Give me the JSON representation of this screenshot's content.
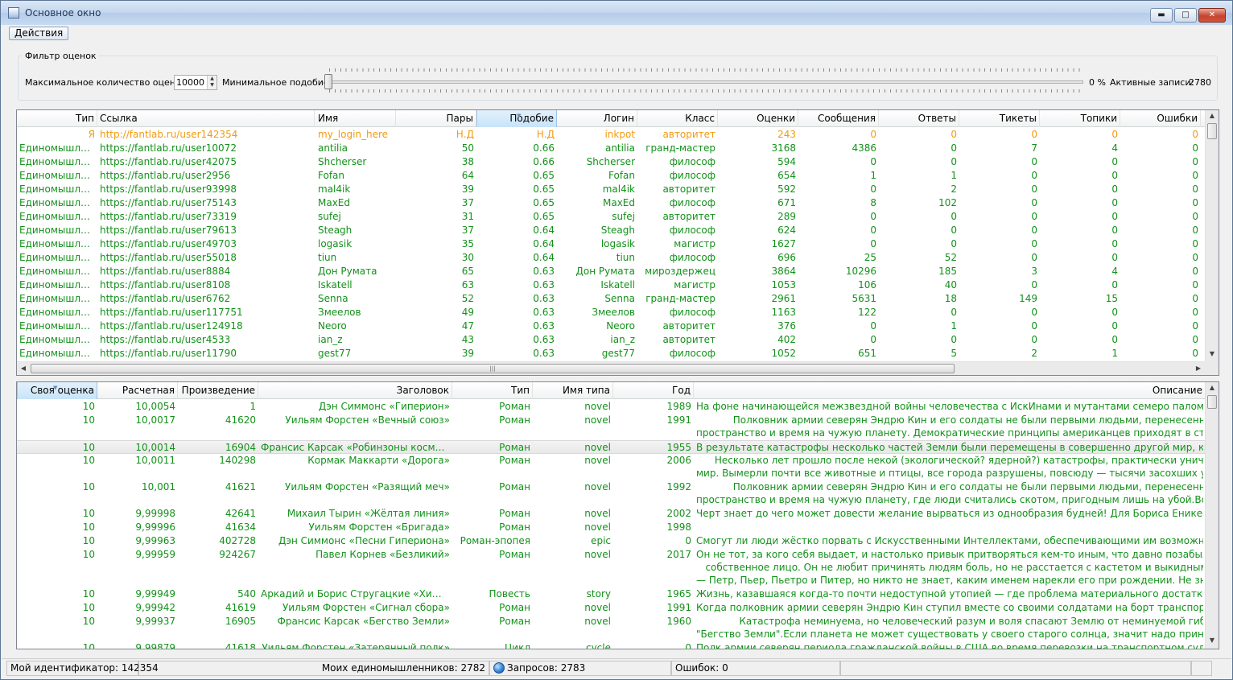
{
  "window": {
    "title": "Основное окно"
  },
  "menu": {
    "actions": "Действия"
  },
  "filter": {
    "group_title": "Фильтр оценок",
    "max_ratings_label": "Максимальное количество оценок:",
    "max_ratings_value": "10000",
    "min_similarity_label": "Минимальное  подобие:",
    "similarity_value": "0 %",
    "active_records_label": "Активные записи:",
    "active_records_value": "2780"
  },
  "colors": {
    "self": "#f39a10",
    "other": "#13911a"
  },
  "users_table": {
    "columns": [
      "Тип",
      "Ссылка",
      "Имя",
      "Пары",
      "Подобие",
      "Логин",
      "Класс",
      "Оценки",
      "Сообщения",
      "Ответы",
      "Тикеты",
      "Топики",
      "Ошибки"
    ],
    "rows": [
      {
        "self": true,
        "cells": [
          "Я",
          "http://fantlab.ru/user142354",
          "my_login_here",
          "Н.Д",
          "Н.Д",
          "inkpot",
          "авторитет",
          "243",
          "0",
          "0",
          "0",
          "0",
          "0"
        ]
      },
      {
        "cells": [
          "Единомышлен...",
          "https://fantlab.ru/user10072",
          "antilia",
          "50",
          "0.66",
          "antilia",
          "гранд-мастер",
          "3168",
          "4386",
          "0",
          "7",
          "4",
          "0"
        ]
      },
      {
        "cells": [
          "Единомышлен...",
          "https://fantlab.ru/user42075",
          "Shcherser",
          "38",
          "0.66",
          "Shcherser",
          "философ",
          "594",
          "0",
          "0",
          "0",
          "0",
          "0"
        ]
      },
      {
        "cells": [
          "Единомышлен...",
          "https://fantlab.ru/user2956",
          "Fofan",
          "64",
          "0.65",
          "Fofan",
          "философ",
          "654",
          "1",
          "1",
          "0",
          "0",
          "0"
        ]
      },
      {
        "cells": [
          "Единомышлен...",
          "https://fantlab.ru/user93998",
          "mal4ik",
          "39",
          "0.65",
          "mal4ik",
          "авторитет",
          "592",
          "0",
          "2",
          "0",
          "0",
          "0"
        ]
      },
      {
        "cells": [
          "Единомышлен...",
          "https://fantlab.ru/user75143",
          "MaxEd",
          "37",
          "0.65",
          "MaxEd",
          "философ",
          "671",
          "8",
          "102",
          "0",
          "0",
          "0"
        ]
      },
      {
        "cells": [
          "Единомышлен...",
          "https://fantlab.ru/user73319",
          "sufej",
          "31",
          "0.65",
          "sufej",
          "авторитет",
          "289",
          "0",
          "0",
          "0",
          "0",
          "0"
        ]
      },
      {
        "cells": [
          "Единомышлен...",
          "https://fantlab.ru/user79613",
          "Steagh",
          "37",
          "0.64",
          "Steagh",
          "философ",
          "624",
          "0",
          "0",
          "0",
          "0",
          "0"
        ]
      },
      {
        "cells": [
          "Единомышлен...",
          "https://fantlab.ru/user49703",
          "logasik",
          "35",
          "0.64",
          "logasik",
          "магистр",
          "1627",
          "0",
          "0",
          "0",
          "0",
          "0"
        ]
      },
      {
        "cells": [
          "Единомышлен...",
          "https://fantlab.ru/user55018",
          "tiun",
          "30",
          "0.64",
          "tiun",
          "философ",
          "696",
          "25",
          "52",
          "0",
          "0",
          "0"
        ]
      },
      {
        "cells": [
          "Единомышлен...",
          "https://fantlab.ru/user8884",
          "Дон Румата",
          "65",
          "0.63",
          "Дон Румата",
          "мироздержец",
          "3864",
          "10296",
          "185",
          "3",
          "4",
          "0"
        ]
      },
      {
        "cells": [
          "Единомышлен...",
          "https://fantlab.ru/user8108",
          "Iskatell",
          "63",
          "0.63",
          "Iskatell",
          "магистр",
          "1053",
          "106",
          "40",
          "0",
          "0",
          "0"
        ]
      },
      {
        "cells": [
          "Единомышлен...",
          "https://fantlab.ru/user6762",
          "Senna",
          "52",
          "0.63",
          "Senna",
          "гранд-мастер",
          "2961",
          "5631",
          "18",
          "149",
          "15",
          "0"
        ]
      },
      {
        "cells": [
          "Единомышлен...",
          "https://fantlab.ru/user117751",
          "Змеелов",
          "49",
          "0.63",
          "Змеелов",
          "философ",
          "1163",
          "122",
          "0",
          "0",
          "0",
          "0"
        ]
      },
      {
        "cells": [
          "Единомышлен...",
          "https://fantlab.ru/user124918",
          "Neoro",
          "47",
          "0.63",
          "Neoro",
          "авторитет",
          "376",
          "0",
          "1",
          "0",
          "0",
          "0"
        ]
      },
      {
        "cells": [
          "Единомышлен...",
          "https://fantlab.ru/user4533",
          "ian_z",
          "43",
          "0.63",
          "ian_z",
          "авторитет",
          "402",
          "0",
          "0",
          "0",
          "0",
          "0"
        ]
      },
      {
        "cells": [
          "Единомышлен...",
          "https://fantlab.ru/user11790",
          "gest77",
          "39",
          "0.63",
          "gest77",
          "философ",
          "1052",
          "651",
          "5",
          "2",
          "1",
          "0"
        ]
      }
    ]
  },
  "works_table": {
    "columns": [
      "Своя оценка",
      "Расчетная",
      "Произведение",
      "Заголовок",
      "Тип",
      "Имя типа",
      "Год",
      "Описание"
    ],
    "rows": [
      {
        "cells": [
          "10",
          "10,0054",
          "1",
          "Дэн Симмонс «Гиперион»",
          "Роман",
          "novel",
          "1989"
        ],
        "desc": [
          "На фоне начинающейся межзвездной войны человечества с ИскИнами и мутантами семеро паломников нап..."
        ]
      },
      {
        "cells": [
          "10",
          "10,0017",
          "41620",
          "Уильям Форстен «Вечный союз»",
          "Роман",
          "novel",
          "1991"
        ],
        "desc": [
          "            Полковник армии северян Эндрю Кин и его солдаты не были первыми людьми, перенесенными через",
          "пространство и время на чужую планету. Демократические принципы американцев приходят в столкновение ..."
        ]
      },
      {
        "selected": true,
        "cells": [
          "10",
          "10,0014",
          "16904",
          "Франсис Карсак «Робинзоны космоса»",
          "Роман",
          "novel",
          "1955"
        ],
        "desc": [
          "В результате катастрофы несколько частей Земли были перемещены в совершенно другой мир, как его в пос..."
        ]
      },
      {
        "cells": [
          "10",
          "10,0011",
          "140298",
          "Кормак Маккарти «Дорога»",
          "Роман",
          "novel",
          "2006"
        ],
        "desc": [
          "      Несколько лет прошло после некой (экологической? ядерной?) катастрофы, практически уничтожившей весь",
          "мир. Вымерли почти все животные и птицы, все города разрушены, повсюду — тысячи засохших уже от старо..."
        ]
      },
      {
        "cells": [
          "10",
          "10,001",
          "41621",
          "Уильям Форстен «Разящий меч»",
          "Роман",
          "novel",
          "1992"
        ],
        "desc": [
          "            Полковник армии северян Эндрю Кин и его солдаты не были первыми людьми, перенесенными через",
          "пространство и время на чужую планету, где люди считались скотом, пригодным лишь на убой.Вступив в бор..."
        ]
      },
      {
        "cells": [
          "10",
          "9,99998",
          "42641",
          "Михаил Тырин «Жёлтая линия»",
          "Роман",
          "novel",
          "2002"
        ],
        "desc": [
          "Черт знает до чего может довести желание вырваться из однообразия будней! Для Бориса Еникеева подобное ..."
        ]
      },
      {
        "cells": [
          "10",
          "9,99996",
          "41634",
          "Уильям Форстен «Бригада»",
          "Роман",
          "novel",
          "1998"
        ],
        "desc": [
          ""
        ]
      },
      {
        "cells": [
          "10",
          "9,99963",
          "402728",
          "Дэн Симмонс «Песни Гипериона»",
          "Роман-эпопея",
          "epic",
          "0"
        ],
        "desc": [
          "Смогут ли люди жёстко порвать с Искусственными Интеллектами, обеспечивающими им возможность связи ..."
        ]
      },
      {
        "cells": [
          "10",
          "9,99959",
          "924267",
          "Павел Корнев «Безликий»",
          "Роман",
          "novel",
          "2017"
        ],
        "desc": [
          "Он не тот, за кого себя выдает, и настолько привык притворяться кем-то иным, что давно позабыл, как выглядит",
          "   собственное лицо. Он не любит причинять людям боль, но не расстается с кастетом и выкидным стилетом. Он",
          "— Петр, Пьер, Пьетро и Питер, но никто не знает, каким именем нарекли его при рождении. Не знает этого да..."
        ]
      },
      {
        "cells": [
          "10",
          "9,99949",
          "540",
          "Аркадий и Борис Стругацкие «Хищные в...",
          "Повесть",
          "story",
          "1965"
        ],
        "desc": [
          "Жизнь, казавшаяся когда-то почти недоступной утопией — где проблема материального достатка благополуч..."
        ]
      },
      {
        "cells": [
          "10",
          "9,99942",
          "41619",
          "Уильям Форстен «Сигнал сбора»",
          "Роман",
          "novel",
          "1991"
        ],
        "desc": [
          "Когда полковник армии северян Эндрю Кин ступил вместе со своими солдатами на борт транспортного судна,..."
        ]
      },
      {
        "cells": [
          "10",
          "9,99937",
          "16905",
          "Франсис Карсак «Бегство Земли»",
          "Роман",
          "novel",
          "1960"
        ],
        "desc": [
          "              Катастрофа неминуема, но человеческий разум и воля спасают Землю от неминуемой гибели в романе",
          "\"Бегство Земли\".Если планета не может существовать у своего старого солнца, значит надо принимать меры..."
        ]
      },
      {
        "cells": [
          "10",
          "9,99879",
          "41618",
          "Уильям Форстен «Затерянный полк»",
          "Цикл",
          "cycle",
          "0"
        ],
        "desc": [
          "Полк армии северян периода гражданской войны в США во время перевозки на транспортном судне попадает..."
        ]
      }
    ]
  },
  "status": {
    "my_id": "Мой идентификатор: 142354",
    "like_minded": "Моих единомышленников: 2782",
    "requests": "Запросов: 2783",
    "errors": "Ошибок: 0"
  }
}
